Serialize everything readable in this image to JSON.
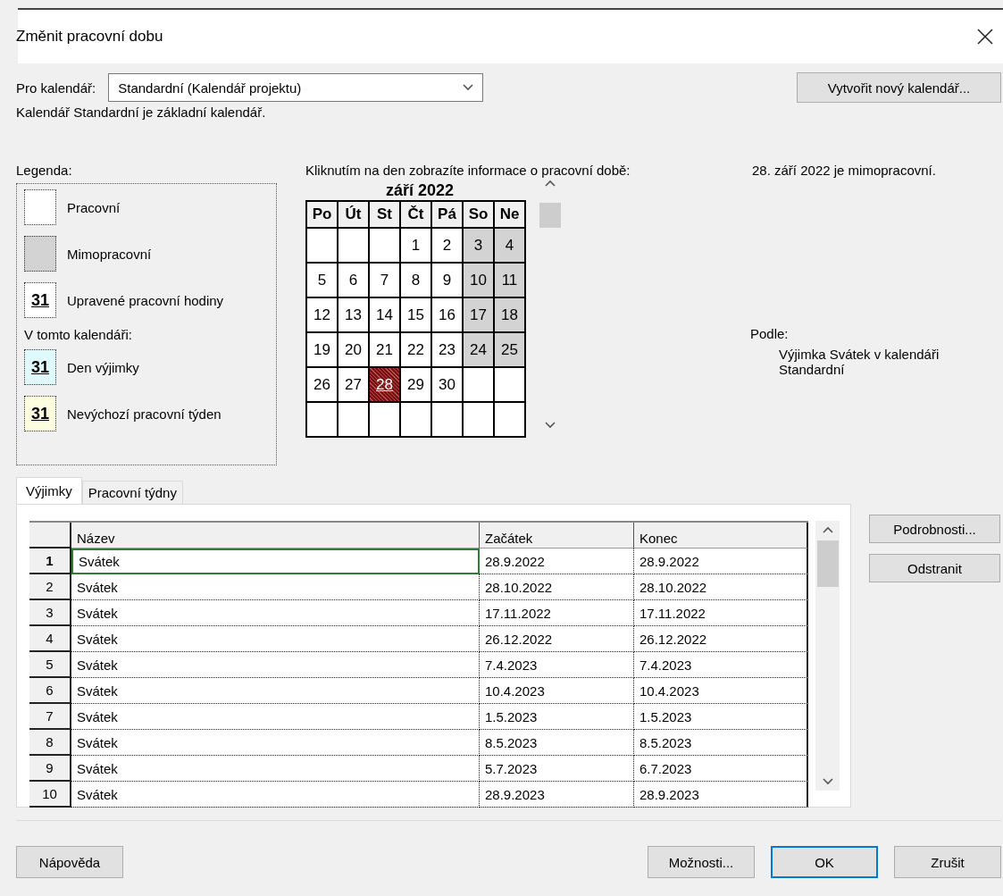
{
  "window": {
    "title": "Změnit pracovní dobu"
  },
  "calendar_select": {
    "label": "Pro kalendář:",
    "value": "Standardní (Kalendář projektu)"
  },
  "new_calendar_button": "Vytvořit nový kalendář...",
  "base_note": "Kalendář Standardní je základní kalendář.",
  "legend": {
    "title": "Legenda:",
    "items": [
      {
        "kind": "working",
        "label": "Pracovní"
      },
      {
        "kind": "nonworking",
        "label": "Mimopracovní"
      },
      {
        "kind": "edited",
        "sample": "31",
        "label": "Upravené pracovní hodiny"
      }
    ],
    "subheading": "V tomto kalendáři:",
    "calendar_items": [
      {
        "kind": "exception",
        "sample": "31",
        "label": "Den výjimky"
      },
      {
        "kind": "nondefault",
        "sample": "31",
        "label": "Nevýchozí pracovní týden"
      }
    ]
  },
  "calendar": {
    "hint": "Kliknutím na den zobrazíte informace o pracovní době:",
    "month": "září 2022",
    "weekdays": [
      "Po",
      "Út",
      "St",
      "Čt",
      "Pá",
      "So",
      "Ne"
    ],
    "weeks": [
      [
        {
          "kind": "blank",
          "selected": false
        },
        {
          "kind": "blank",
          "selected": false
        },
        {
          "kind": "blank",
          "selected": false
        },
        {
          "day": "1",
          "kind": "working",
          "selected": false
        },
        {
          "day": "2",
          "kind": "working",
          "selected": false
        },
        {
          "day": "3",
          "kind": "nonworking",
          "selected": false
        },
        {
          "day": "4",
          "kind": "nonworking",
          "selected": false
        }
      ],
      [
        {
          "day": "5",
          "kind": "working",
          "selected": false
        },
        {
          "day": "6",
          "kind": "working",
          "selected": false
        },
        {
          "day": "7",
          "kind": "working",
          "selected": false
        },
        {
          "day": "8",
          "kind": "working",
          "selected": false
        },
        {
          "day": "9",
          "kind": "working",
          "selected": false
        },
        {
          "day": "10",
          "kind": "nonworking",
          "selected": false
        },
        {
          "day": "11",
          "kind": "nonworking",
          "selected": false
        }
      ],
      [
        {
          "day": "12",
          "kind": "working",
          "selected": false
        },
        {
          "day": "13",
          "kind": "working",
          "selected": false
        },
        {
          "day": "14",
          "kind": "working",
          "selected": false
        },
        {
          "day": "15",
          "kind": "working",
          "selected": false
        },
        {
          "day": "16",
          "kind": "working",
          "selected": false
        },
        {
          "day": "17",
          "kind": "nonworking",
          "selected": false
        },
        {
          "day": "18",
          "kind": "nonworking",
          "selected": false
        }
      ],
      [
        {
          "day": "19",
          "kind": "working",
          "selected": false
        },
        {
          "day": "20",
          "kind": "working",
          "selected": false
        },
        {
          "day": "21",
          "kind": "working",
          "selected": false
        },
        {
          "day": "22",
          "kind": "working",
          "selected": false
        },
        {
          "day": "23",
          "kind": "working",
          "selected": false
        },
        {
          "day": "24",
          "kind": "nonworking",
          "selected": false
        },
        {
          "day": "25",
          "kind": "nonworking",
          "selected": false
        }
      ],
      [
        {
          "day": "26",
          "kind": "working",
          "selected": false
        },
        {
          "day": "27",
          "kind": "working",
          "selected": false
        },
        {
          "day": "28",
          "kind": "exception",
          "selected": true
        },
        {
          "day": "29",
          "kind": "working",
          "selected": false
        },
        {
          "day": "30",
          "kind": "working",
          "selected": false
        },
        {
          "kind": "blank",
          "selected": false
        },
        {
          "kind": "blank",
          "selected": false
        }
      ],
      [
        {
          "kind": "blank",
          "selected": false
        },
        {
          "kind": "blank",
          "selected": false
        },
        {
          "kind": "blank",
          "selected": false
        },
        {
          "kind": "blank",
          "selected": false
        },
        {
          "kind": "blank",
          "selected": false
        },
        {
          "kind": "blank",
          "selected": false
        },
        {
          "kind": "blank",
          "selected": false
        }
      ]
    ]
  },
  "day_info": {
    "status": "28. září 2022 je mimopracovní.",
    "basis_label": "Podle:",
    "basis": "Výjimka Svátek v kalendáři Standardní"
  },
  "tabs": [
    {
      "label": "Výjimky",
      "selected": true
    },
    {
      "label": "Pracovní týdny",
      "selected": false
    }
  ],
  "table": {
    "columns": [
      "Název",
      "Začátek",
      "Konec"
    ],
    "rows": [
      {
        "num": "1",
        "name": "Svátek",
        "start": "28.9.2022",
        "end": "28.9.2022",
        "selected": true
      },
      {
        "num": "2",
        "name": "Svátek",
        "start": "28.10.2022",
        "end": "28.10.2022",
        "selected": false
      },
      {
        "num": "3",
        "name": "Svátek",
        "start": "17.11.2022",
        "end": "17.11.2022",
        "selected": false
      },
      {
        "num": "4",
        "name": "Svátek",
        "start": "26.12.2022",
        "end": "26.12.2022",
        "selected": false
      },
      {
        "num": "5",
        "name": "Svátek",
        "start": "7.4.2023",
        "end": "7.4.2023",
        "selected": false
      },
      {
        "num": "6",
        "name": "Svátek",
        "start": "10.4.2023",
        "end": "10.4.2023",
        "selected": false
      },
      {
        "num": "7",
        "name": "Svátek",
        "start": "1.5.2023",
        "end": "1.5.2023",
        "selected": false
      },
      {
        "num": "8",
        "name": "Svátek",
        "start": "8.5.2023",
        "end": "8.5.2023",
        "selected": false
      },
      {
        "num": "9",
        "name": "Svátek",
        "start": "5.7.2023",
        "end": "6.7.2023",
        "selected": false
      },
      {
        "num": "10",
        "name": "Svátek",
        "start": "28.9.2023",
        "end": "28.9.2023",
        "selected": false
      }
    ]
  },
  "side_buttons": [
    "Podrobnosti...",
    "Odstranit"
  ],
  "footer_buttons": [
    {
      "label": "Nápověda",
      "default": false
    },
    {
      "label": "Možnosti...",
      "default": false
    },
    {
      "label": "OK",
      "default": true
    },
    {
      "label": "Zrušit",
      "default": false
    }
  ]
}
